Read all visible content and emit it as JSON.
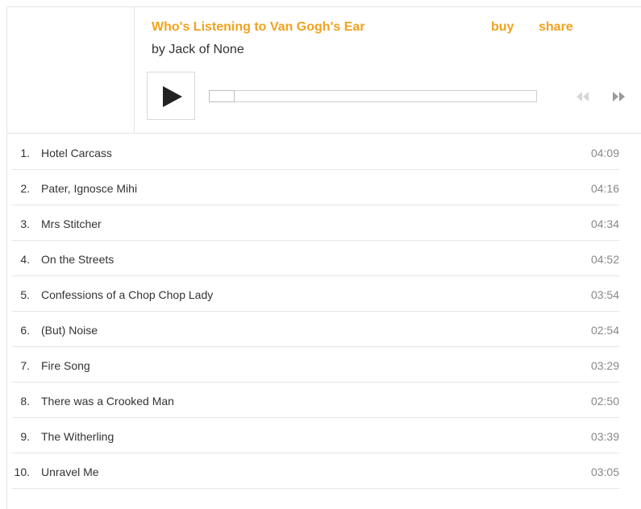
{
  "album": {
    "title": "Who's Listening to Van Gogh's Ear",
    "artist": "by Jack of None",
    "buy_label": "buy",
    "share_label": "share"
  },
  "player": {
    "progress": 0.0,
    "icons": {
      "play": "play-icon",
      "prev": "previous-track-icon",
      "next": "next-track-icon"
    }
  },
  "colors": {
    "accent": "#f2a21e",
    "text": "#333333",
    "duration": "#888888",
    "divider": "#e5e5e5",
    "prev_disabled": "#d6d6d6",
    "next_enabled": "#9a9a9a"
  },
  "tracks": [
    {
      "num": "1.",
      "title": "Hotel Carcass",
      "duration": "04:09"
    },
    {
      "num": "2.",
      "title": "Pater, Ignosce Mihi",
      "duration": "04:16"
    },
    {
      "num": "3.",
      "title": "Mrs Stitcher",
      "duration": "04:34"
    },
    {
      "num": "4.",
      "title": "On the Streets",
      "duration": "04:52"
    },
    {
      "num": "5.",
      "title": "Confessions of a Chop Chop Lady",
      "duration": "03:54"
    },
    {
      "num": "6.",
      "title": "(But) Noise",
      "duration": "02:54"
    },
    {
      "num": "7.",
      "title": "Fire Song",
      "duration": "03:29"
    },
    {
      "num": "8.",
      "title": "There was a Crooked Man",
      "duration": "02:50"
    },
    {
      "num": "9.",
      "title": "The Witherling",
      "duration": "03:39"
    },
    {
      "num": "10.",
      "title": "Unravel Me",
      "duration": "03:05"
    }
  ]
}
